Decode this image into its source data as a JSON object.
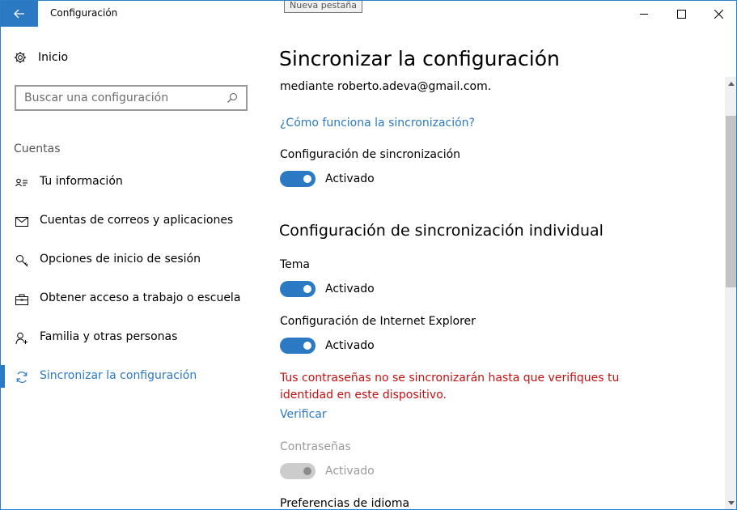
{
  "window": {
    "title": "Configuración",
    "tooltip": "Nueva pestaña"
  },
  "colors": {
    "accent": "#2b79c2",
    "warning": "#c50f0f",
    "disabled": "#9a9a9a"
  },
  "sidebar": {
    "home_label": "Inicio",
    "search_placeholder": "Buscar una configuración",
    "section_title": "Cuentas",
    "items": [
      {
        "label": "Tu información",
        "icon": "person-card-icon"
      },
      {
        "label": "Cuentas de correos y aplicaciones",
        "icon": "mail-icon"
      },
      {
        "label": "Opciones de inicio de sesión",
        "icon": "key-icon"
      },
      {
        "label": "Obtener acceso a trabajo o escuela",
        "icon": "briefcase-icon"
      },
      {
        "label": "Familia y otras personas",
        "icon": "person-add-icon"
      },
      {
        "label": "Sincronizar la configuración",
        "icon": "sync-icon",
        "active": true
      }
    ]
  },
  "main": {
    "title": "Sincronizar la configuración",
    "account_text": "mediante roberto.adeva@gmail.com.",
    "how_link": "¿Cómo funciona la sincronización?",
    "sync_settings": {
      "label": "Configuración de sincronización",
      "state": "Activado",
      "on": true
    },
    "individual_heading": "Configuración de sincronización individual",
    "theme": {
      "label": "Tema",
      "state": "Activado",
      "on": true
    },
    "ie": {
      "label": "Configuración de Internet Explorer",
      "state": "Activado",
      "on": true
    },
    "warning_line1": "Tus contraseñas no se sincronizarán hasta que verifiques tu",
    "warning_line2": "identidad en este dispositivo.",
    "verify_link": "Verificar",
    "passwords": {
      "label": "Contraseñas",
      "state": "Activado",
      "on": true,
      "disabled": true
    },
    "language_label": "Preferencias de idioma"
  }
}
